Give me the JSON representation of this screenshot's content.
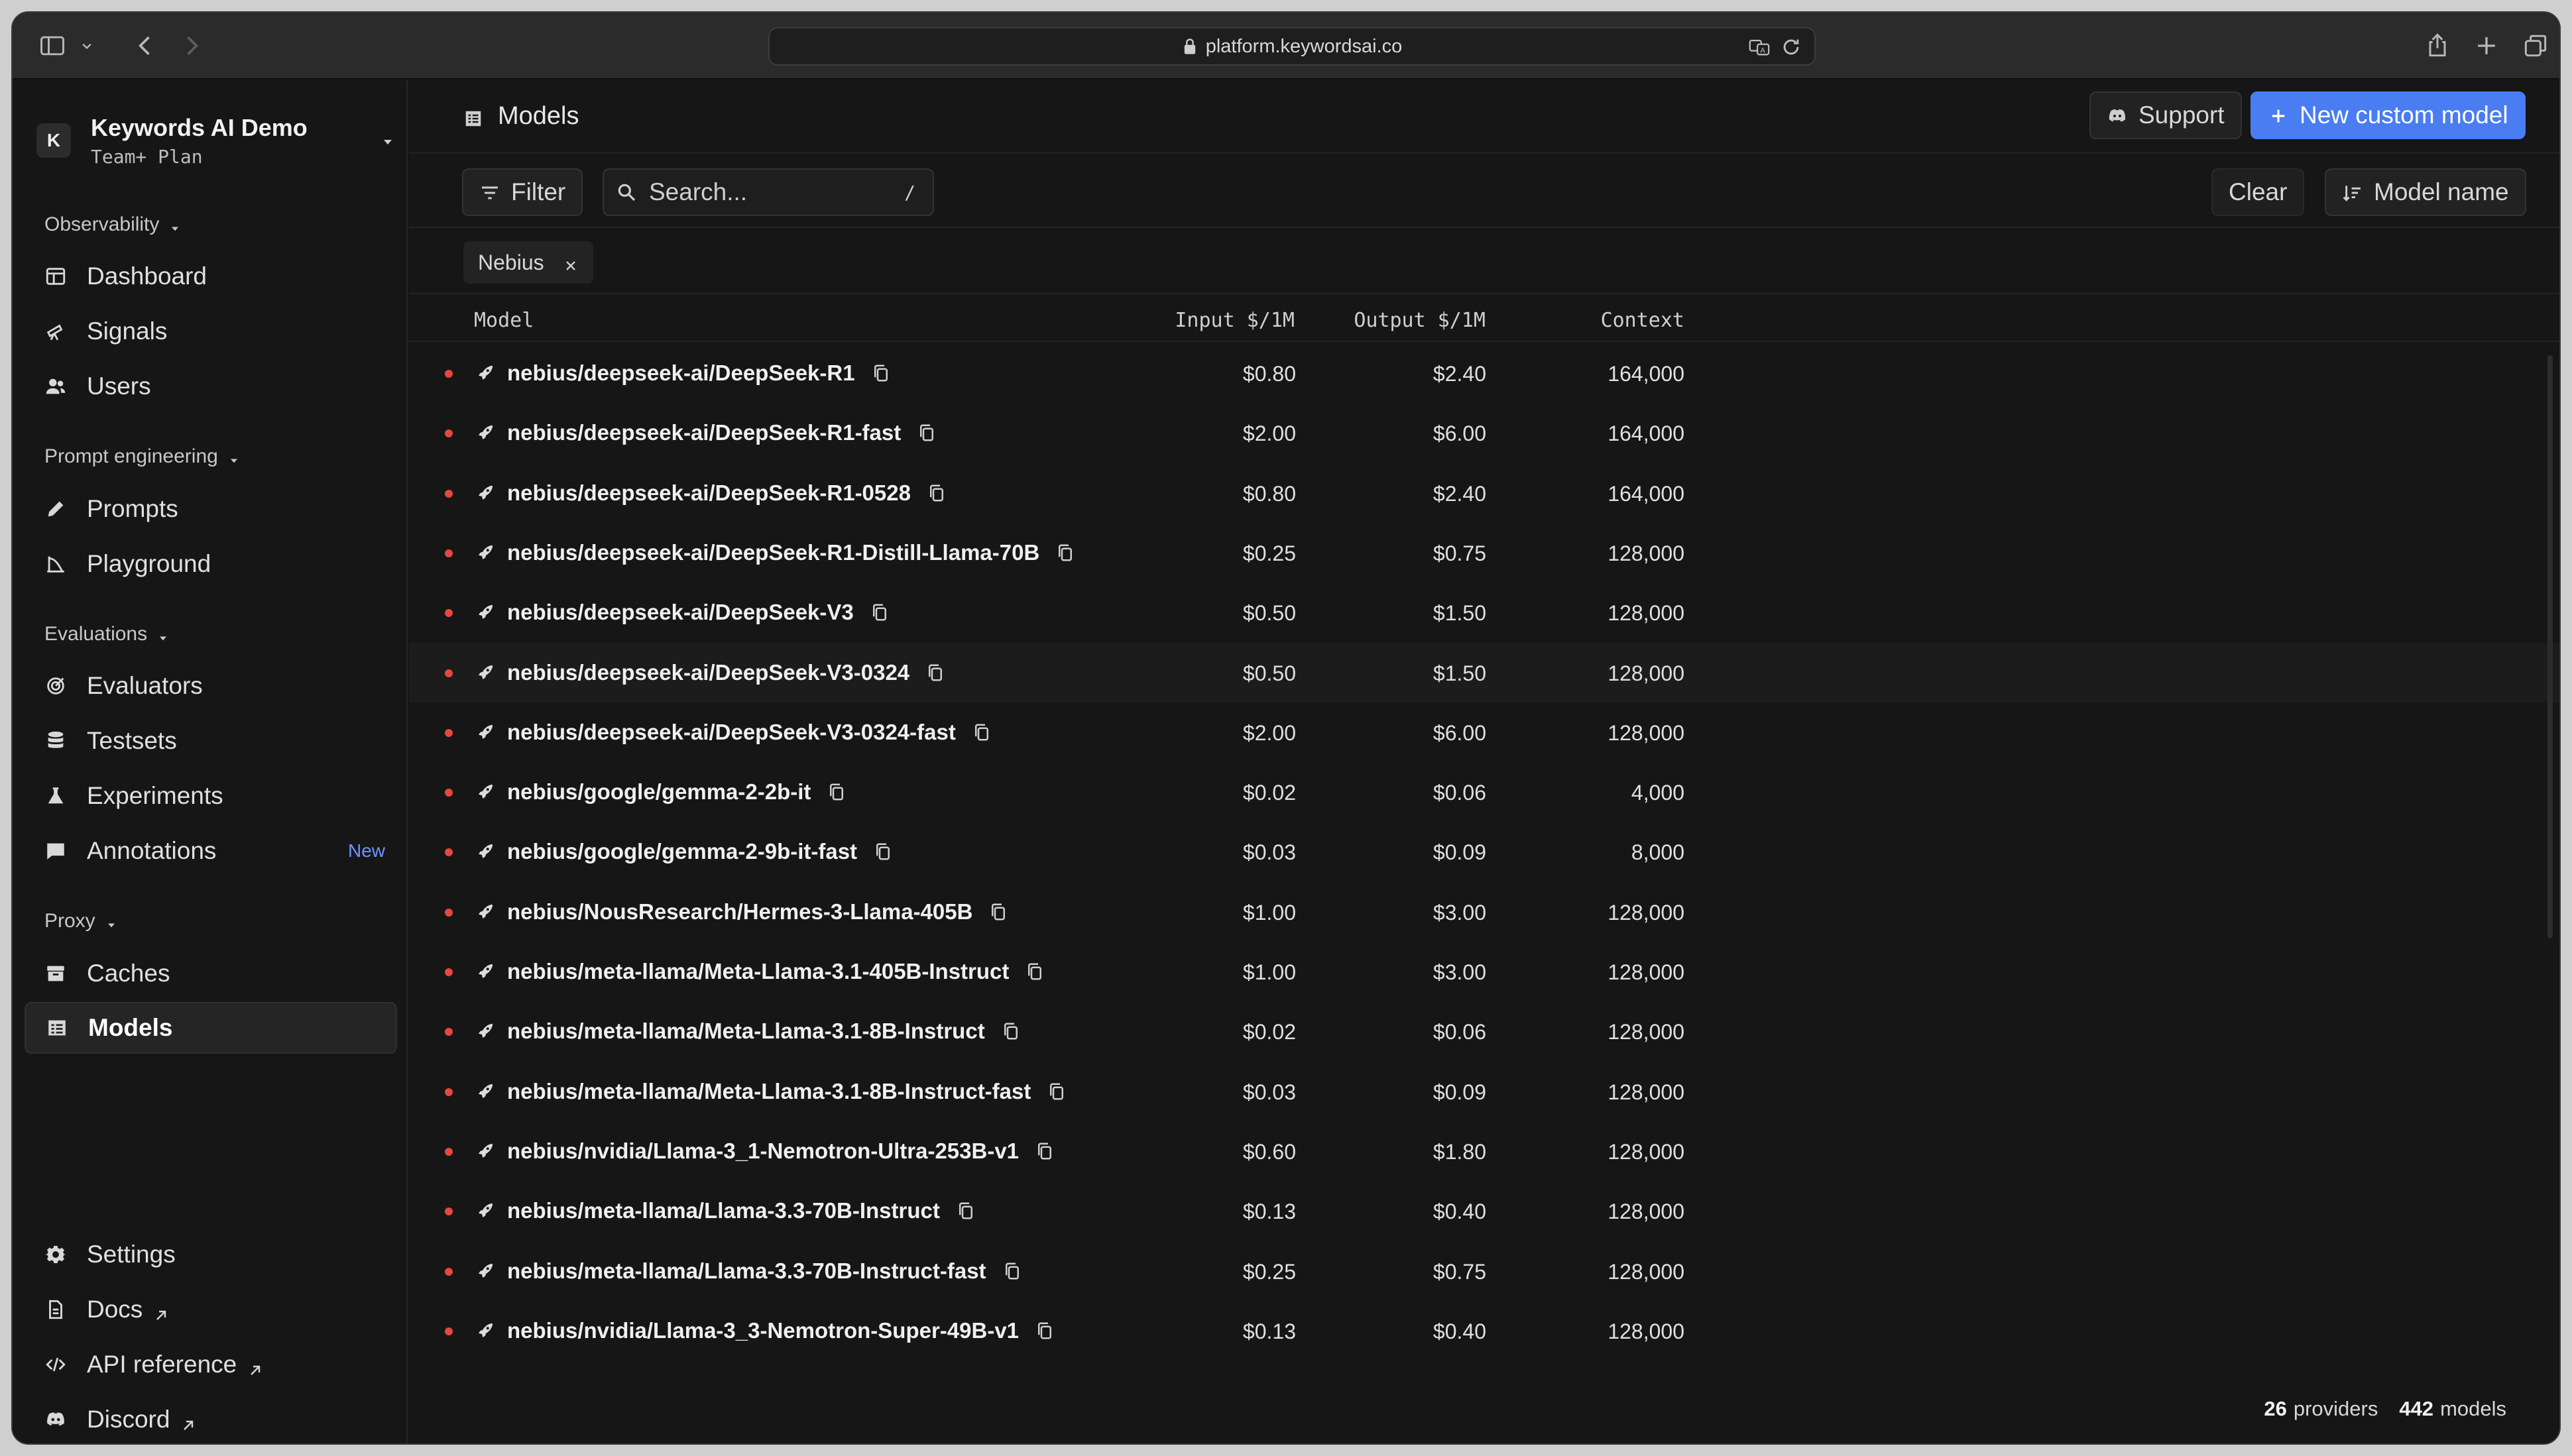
{
  "browser": {
    "url": "platform.keywordsai.co"
  },
  "workspace": {
    "initial": "K",
    "name": "Keywords AI Demo",
    "plan": "Team+ Plan"
  },
  "sidebar": {
    "sections": [
      {
        "label": "Observability",
        "items": [
          {
            "label": "Dashboard",
            "icon": "dashboard-icon"
          },
          {
            "label": "Signals",
            "icon": "telescope-icon"
          },
          {
            "label": "Users",
            "icon": "users-icon"
          }
        ]
      },
      {
        "label": "Prompt engineering",
        "items": [
          {
            "label": "Prompts",
            "icon": "pencil-icon"
          },
          {
            "label": "Playground",
            "icon": "playground-icon"
          }
        ]
      },
      {
        "label": "Evaluations",
        "items": [
          {
            "label": "Evaluators",
            "icon": "target-icon"
          },
          {
            "label": "Testsets",
            "icon": "database-icon"
          },
          {
            "label": "Experiments",
            "icon": "flask-icon"
          },
          {
            "label": "Annotations",
            "icon": "annotation-icon",
            "badge": "New"
          }
        ]
      },
      {
        "label": "Proxy",
        "items": [
          {
            "label": "Caches",
            "icon": "archive-icon"
          },
          {
            "label": "Models",
            "icon": "table-icon",
            "active": true
          }
        ]
      }
    ],
    "bottom": [
      {
        "label": "Settings",
        "icon": "gear-icon"
      },
      {
        "label": "Docs",
        "icon": "document-icon",
        "external": true
      },
      {
        "label": "API reference",
        "icon": "code-icon",
        "external": true
      },
      {
        "label": "Discord",
        "icon": "discord-icon",
        "external": true
      }
    ]
  },
  "header": {
    "title": "Models",
    "support_label": "Support",
    "new_model_label": "New custom model"
  },
  "toolbar": {
    "filter_label": "Filter",
    "search_placeholder": "Search...",
    "search_shortcut": "/",
    "clear_label": "Clear",
    "sort_label": "Model name"
  },
  "active_filters": [
    "Nebius"
  ],
  "table": {
    "columns": {
      "model": "Model",
      "input": "Input $/1M",
      "output": "Output $/1M",
      "context": "Context"
    },
    "rows": [
      {
        "model": "nebius/deepseek-ai/DeepSeek-R1",
        "input": "$0.80",
        "output": "$2.40",
        "context": "164,000"
      },
      {
        "model": "nebius/deepseek-ai/DeepSeek-R1-fast",
        "input": "$2.00",
        "output": "$6.00",
        "context": "164,000"
      },
      {
        "model": "nebius/deepseek-ai/DeepSeek-R1-0528",
        "input": "$0.80",
        "output": "$2.40",
        "context": "164,000"
      },
      {
        "model": "nebius/deepseek-ai/DeepSeek-R1-Distill-Llama-70B",
        "input": "$0.25",
        "output": "$0.75",
        "context": "128,000"
      },
      {
        "model": "nebius/deepseek-ai/DeepSeek-V3",
        "input": "$0.50",
        "output": "$1.50",
        "context": "128,000"
      },
      {
        "model": "nebius/deepseek-ai/DeepSeek-V3-0324",
        "input": "$0.50",
        "output": "$1.50",
        "context": "128,000",
        "highlighted": true
      },
      {
        "model": "nebius/deepseek-ai/DeepSeek-V3-0324-fast",
        "input": "$2.00",
        "output": "$6.00",
        "context": "128,000"
      },
      {
        "model": "nebius/google/gemma-2-2b-it",
        "input": "$0.02",
        "output": "$0.06",
        "context": "4,000"
      },
      {
        "model": "nebius/google/gemma-2-9b-it-fast",
        "input": "$0.03",
        "output": "$0.09",
        "context": "8,000"
      },
      {
        "model": "nebius/NousResearch/Hermes-3-Llama-405B",
        "input": "$1.00",
        "output": "$3.00",
        "context": "128,000"
      },
      {
        "model": "nebius/meta-llama/Meta-Llama-3.1-405B-Instruct",
        "input": "$1.00",
        "output": "$3.00",
        "context": "128,000"
      },
      {
        "model": "nebius/meta-llama/Meta-Llama-3.1-8B-Instruct",
        "input": "$0.02",
        "output": "$0.06",
        "context": "128,000"
      },
      {
        "model": "nebius/meta-llama/Meta-Llama-3.1-8B-Instruct-fast",
        "input": "$0.03",
        "output": "$0.09",
        "context": "128,000"
      },
      {
        "model": "nebius/nvidia/Llama-3_1-Nemotron-Ultra-253B-v1",
        "input": "$0.60",
        "output": "$1.80",
        "context": "128,000"
      },
      {
        "model": "nebius/meta-llama/Llama-3.3-70B-Instruct",
        "input": "$0.13",
        "output": "$0.40",
        "context": "128,000"
      },
      {
        "model": "nebius/meta-llama/Llama-3.3-70B-Instruct-fast",
        "input": "$0.25",
        "output": "$0.75",
        "context": "128,000"
      },
      {
        "model": "nebius/nvidia/Llama-3_3-Nemotron-Super-49B-v1",
        "input": "$0.13",
        "output": "$0.40",
        "context": "128,000"
      }
    ]
  },
  "footer": {
    "providers_count": "26",
    "providers_label": "providers",
    "models_count": "442",
    "models_label": "models"
  },
  "colors": {
    "accent": "#4a7cf2",
    "status_dot": "#e5483f",
    "new_badge": "#6f94ff"
  }
}
